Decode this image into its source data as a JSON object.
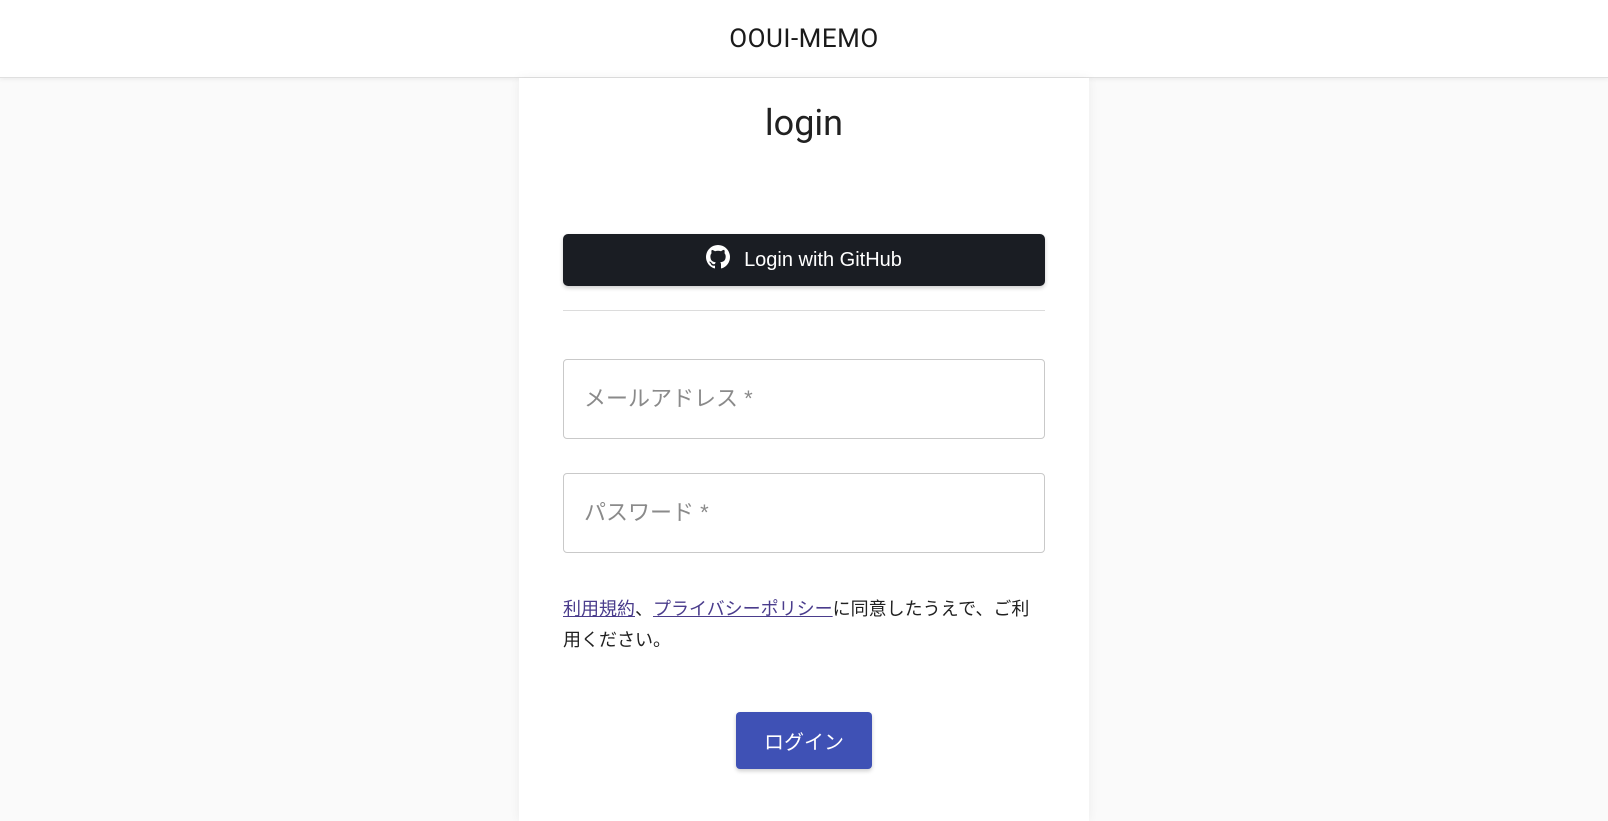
{
  "header": {
    "title": "OOUI-MEMO"
  },
  "page": {
    "title": "login"
  },
  "github": {
    "label": "Login with GitHub"
  },
  "form": {
    "email_placeholder": "メールアドレス *",
    "password_placeholder": "パスワード *",
    "login_button": "ログイン"
  },
  "terms": {
    "link_terms": "利用規約",
    "separator": "、",
    "link_privacy": "プライバシーポリシー",
    "suffix": "に同意したうえで、ご利用ください。"
  }
}
